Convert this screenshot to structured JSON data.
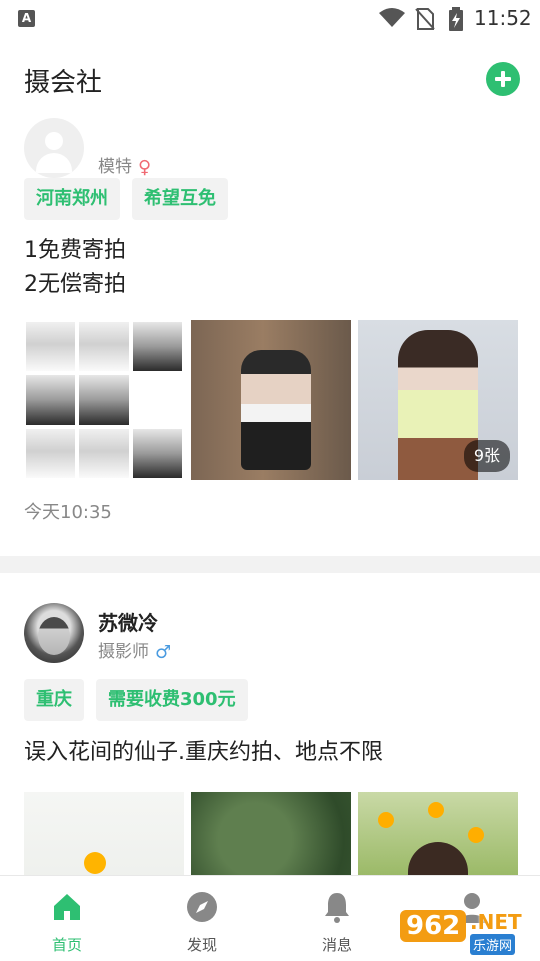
{
  "status_bar": {
    "left_icon": "A",
    "time": "11:52",
    "icons": [
      "wifi-icon",
      "no-sim-icon",
      "battery-charging-icon"
    ]
  },
  "header": {
    "title": "摄会社",
    "add_icon": "plus-circle-icon"
  },
  "posts": [
    {
      "name": "",
      "role": "模特",
      "gender": "female",
      "gender_symbol": "♀",
      "tags": [
        "河南郑州",
        "希望互免"
      ],
      "desc_lines": [
        "1免费寄拍",
        "2无偿寄拍"
      ],
      "photos": [
        "collage-photo",
        "photo",
        "photo"
      ],
      "photo_count_badge": "9张",
      "time": "今天10:35"
    },
    {
      "name": "苏微冷",
      "role": "摄影师",
      "gender": "male",
      "gender_symbol": "♂",
      "tags": [
        "重庆",
        "需要收费300元"
      ],
      "desc_lines": [
        "误入花间的仙子.重庆约拍、地点不限"
      ],
      "photos": [
        "photo",
        "photo",
        "photo"
      ]
    }
  ],
  "tabbar": {
    "tabs": [
      {
        "label": "首页",
        "icon": "home-icon",
        "active": true
      },
      {
        "label": "发现",
        "icon": "compass-icon",
        "active": false
      },
      {
        "label": "消息",
        "icon": "bell-icon",
        "active": false
      },
      {
        "label": "",
        "icon": "user-icon",
        "active": false
      }
    ]
  },
  "watermark": {
    "logo": "962",
    "suffix": ".NET",
    "text": "乐游网"
  },
  "colors": {
    "accent": "#2ebf72",
    "female": "#f06a73",
    "male": "#4a9be0"
  }
}
